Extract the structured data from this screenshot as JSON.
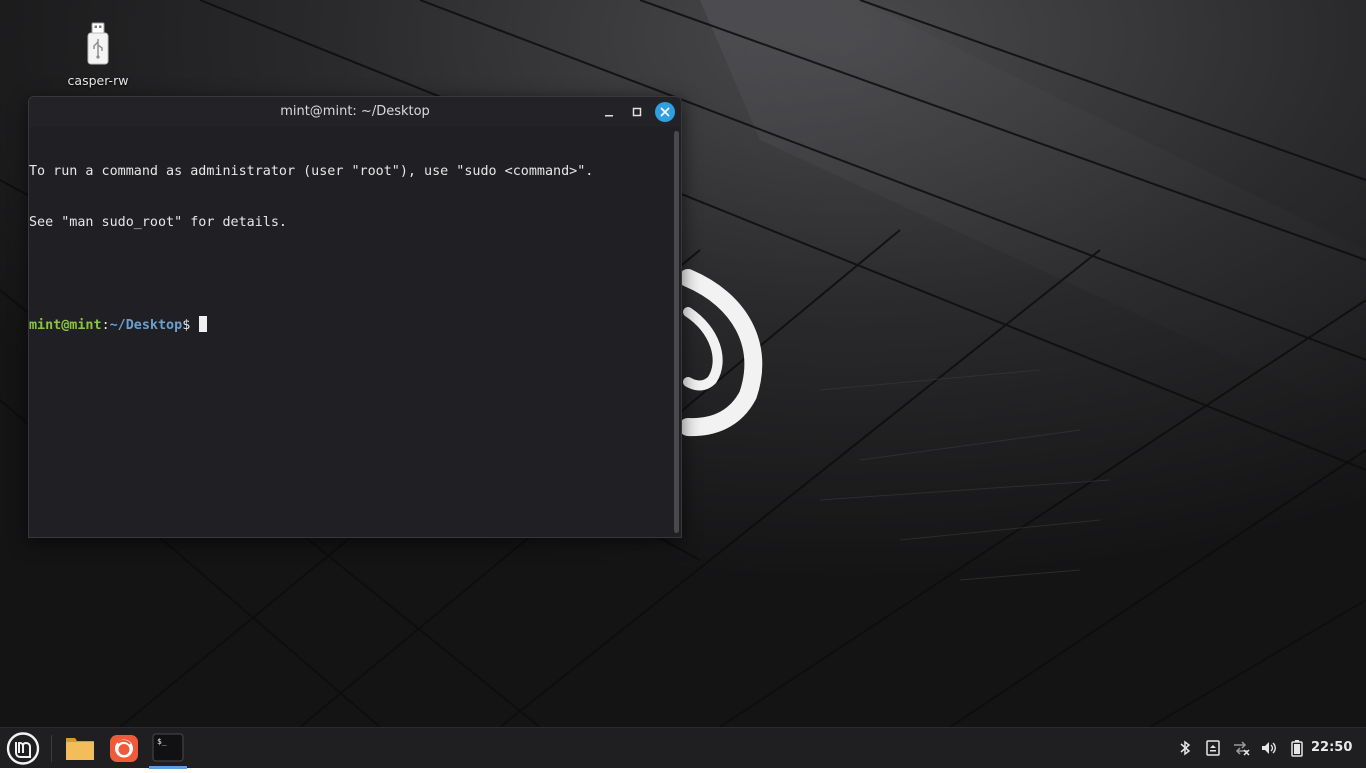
{
  "desktop": {
    "icons": [
      {
        "label": "casper-rw",
        "icon": "usb-drive-icon"
      }
    ]
  },
  "terminal": {
    "title": "mint@mint: ~/Desktop",
    "lines": [
      "To run a command as administrator (user \"root\"), use \"sudo <command>\".",
      "See \"man sudo_root\" for details.",
      ""
    ],
    "prompt": {
      "user_host": "mint@mint",
      "separator": ":",
      "path": "~/Desktop",
      "symbol": "$ "
    }
  },
  "taskbar": {
    "menu_icon": "linux-mint-logo-icon",
    "launchers": [
      "file-manager-icon",
      "firefox-icon",
      "terminal-icon"
    ],
    "tray": [
      "bluetooth-icon",
      "notes-icon",
      "network-disconnected-icon",
      "volume-icon",
      "battery-icon"
    ],
    "clock": "22:50"
  },
  "colors": {
    "accent": "#2f9fe0",
    "prompt_user": "#8ac53e",
    "prompt_path": "#6a9fd0"
  }
}
